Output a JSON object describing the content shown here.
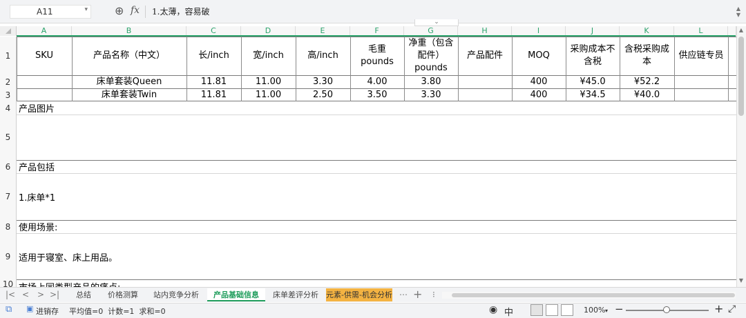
{
  "formula_bar": {
    "cell_ref": "A11",
    "zoom_icon": "zoom-icon",
    "fx_label": "fx",
    "formula": "1.太薄，容易破"
  },
  "columns": [
    "A",
    "B",
    "C",
    "D",
    "E",
    "F",
    "G",
    "H",
    "I",
    "J",
    "K",
    "L"
  ],
  "rows": {
    "r1": "1",
    "r2": "2",
    "r3": "3",
    "r4": "4",
    "r5": "5",
    "r6": "6",
    "r7": "7",
    "r8": "8",
    "r9": "9",
    "r10": "10"
  },
  "table": {
    "headers": {
      "sku": "SKU",
      "name": "产品名称（中文）",
      "length": "长/inch",
      "width": "宽/inch",
      "height": "高/inch",
      "gross": "毛重\npounds",
      "net": "净重（包含\n配件）\npounds",
      "accessory": "产品配件",
      "moq": "MOQ",
      "cost": "采购成本不\n含税",
      "cost_tax": "含税采购成\n本",
      "supplier": "供应链专员"
    },
    "data_rows": [
      {
        "sku": "",
        "name": "床单套装Queen",
        "length": "11.81",
        "width": "11.00",
        "height": "3.30",
        "gross": "4.00",
        "net": "3.80",
        "accessory": "",
        "moq": "400",
        "cost": "¥45.0",
        "cost_tax": "¥52.2",
        "supplier": ""
      },
      {
        "sku": "",
        "name": "床单套装Twin",
        "length": "11.81",
        "width": "11.00",
        "height": "2.50",
        "gross": "3.50",
        "net": "3.30",
        "accessory": "",
        "moq": "400",
        "cost": "¥34.5",
        "cost_tax": "¥40.0",
        "supplier": ""
      }
    ]
  },
  "sections": {
    "image_label": "产品图片",
    "includes_label": "产品包括",
    "includes_value": "1.床单*1",
    "scene_label": "使用场景:",
    "scene_value": "适用于寝室、床上用品。",
    "pain_label": "市场上同类型产品的痛点:"
  },
  "sheet_tabs": [
    "总结",
    "价格测算",
    "站内竞争分析",
    "产品基础信息",
    "床单差评分析",
    "元素-供需-机会分析"
  ],
  "active_tab": "产品基础信息",
  "tab_more": "⋯",
  "tab_add": "+",
  "status": {
    "save_label": "进销存",
    "stats": "平均值=0  计数=1  求和=0",
    "ime_label": "中",
    "zoom": "100%",
    "zoom_minus": "−",
    "zoom_plus": "+"
  },
  "colors": {
    "accent": "#1f9d5c",
    "orange_tab": "#f4b342",
    "header_text": "#2aa36b"
  }
}
